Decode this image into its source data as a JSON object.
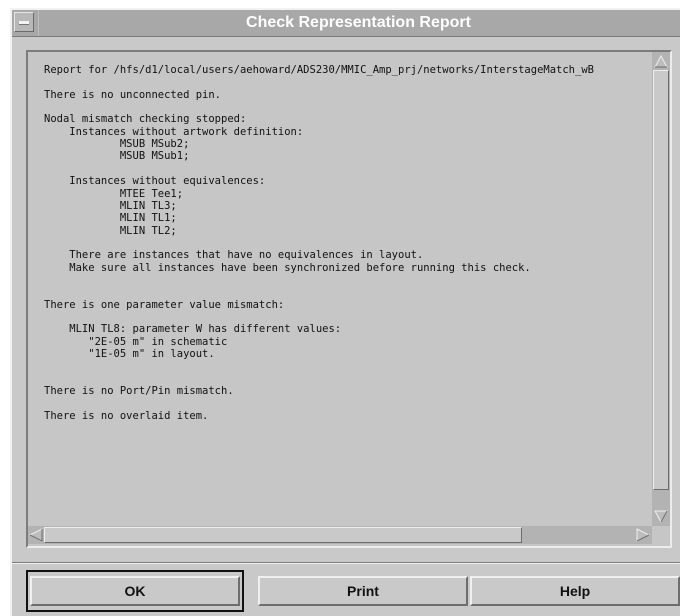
{
  "window": {
    "title": "Check Representation Report"
  },
  "report": {
    "lines": [
      "Report for /hfs/d1/local/users/aehoward/ADS230/MMIC_Amp_prj/networks/InterstageMatch_wB",
      "",
      "There is no unconnected pin.",
      "",
      "Nodal mismatch checking stopped:",
      "    Instances without artwork definition:",
      "            MSUB MSub2;",
      "            MSUB MSub1;",
      "",
      "    Instances without equivalences:",
      "            MTEE Tee1;",
      "            MLIN TL3;",
      "            MLIN TL1;",
      "            MLIN TL2;",
      "",
      "    There are instances that have no equivalences in layout.",
      "    Make sure all instances have been synchronized before running this check.",
      "",
      "",
      "There is one parameter value mismatch:",
      "",
      "    MLIN TL8: parameter W has different values:",
      "       \"2E-05 m\" in schematic",
      "       \"1E-05 m\" in layout.",
      "",
      "",
      "There is no Port/Pin mismatch.",
      "",
      "There is no overlaid item."
    ]
  },
  "buttons": {
    "ok": "OK",
    "print": "Print",
    "help": "Help"
  },
  "icons": {
    "window_menu": "window-menu-icon",
    "scroll_up": "triangle-up-icon",
    "scroll_down": "triangle-down-icon",
    "scroll_left": "triangle-left-icon",
    "scroll_right": "triangle-right-icon"
  }
}
